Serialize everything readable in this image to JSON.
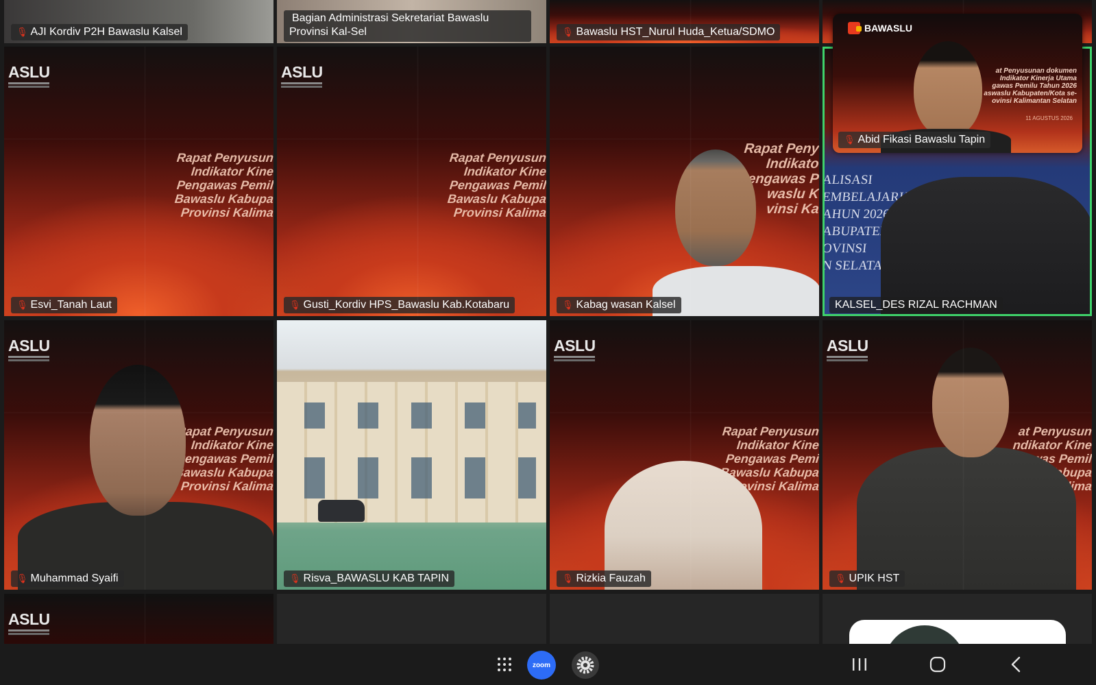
{
  "tiles": {
    "t1": {
      "name": "AJI Kordiv P2H Bawaslu Kalsel"
    },
    "t2": {
      "name": "Bagian Administrasi Sekretariat Bawaslu Provinsi Kal-Sel"
    },
    "t3": {
      "name": "Bawaslu HST_Nurul Huda_Ketua/SDMO"
    },
    "t5": {
      "name": "Esvi_Tanah Laut",
      "logo": "ASLU",
      "slide": [
        "Rapat Penyusun",
        "Indikator Kine",
        "Pengawas Pemil",
        "Bawaslu Kabupa",
        "Provinsi Kalima"
      ]
    },
    "t6": {
      "name": "Gusti_Kordiv HPS_Bawaslu Kab.Kotabaru",
      "logo": "ASLU",
      "slide": [
        "Rapat Penyusun",
        "Indikator Kine",
        "Pengawas Pemil",
        "Bawaslu Kabupa",
        "Provinsi Kalima"
      ]
    },
    "t7": {
      "name": "Kabag wasan Kalsel",
      "slide": [
        "Rapat Peny",
        "Indikato",
        "Pengawas P",
        "waslu K",
        "vinsi Ka"
      ]
    },
    "t8": {
      "name": "KALSEL_DES RIZAL RACHMAN",
      "slide": [
        "ALISASI",
        "EMBELAJARKAN",
        "AHUN 2026",
        "ABUPATEN /",
        "OVINSI",
        "N SELATAN"
      ]
    },
    "t9": {
      "name": "Muhammad Syaifi",
      "logo": "ASLU",
      "slide": [
        "Rapat Penyusun",
        "Indikator Kine",
        "Pengawas Pemil",
        "Bawaslu Kabupa",
        "Provinsi Kalima"
      ]
    },
    "t10": {
      "name": "Risva_BAWASLU KAB TAPIN"
    },
    "t11": {
      "name": "Rizkia Fauzah",
      "logo": "ASLU",
      "slide": [
        "Rapat Penyusun",
        "Indikator Kine",
        "Pengawas Pemi",
        "Bawaslu Kabupa",
        "Provinsi Kalima"
      ]
    },
    "t12": {
      "name": "UPIK HST",
      "logo": "ASLU",
      "slide": [
        "at Penyusun",
        "ndikator Kine",
        "gawas Pemil",
        "waslu Kabupa",
        "vinsi Kalima"
      ]
    },
    "t13": {
      "logo": "ASLU"
    }
  },
  "pip": {
    "name": "Abid Fikasi Bawaslu Tapin",
    "logo": "BAWASLU",
    "slide": [
      "at Penyusunan dokumen",
      "Indikator Kinerja Utama",
      "gawas Pemilu Tahun 2026",
      "aswaslu Kabupaten/Kota se-",
      "ovinsi Kalimantan Selatan"
    ],
    "date": "11 AGUSTUS 2026"
  },
  "navbar": {
    "zoom_label": "zoom",
    "icons": [
      "apps-grid-icon",
      "zoom-app-icon",
      "settings-gear-icon",
      "recent-apps-icon",
      "home-icon",
      "back-icon"
    ]
  }
}
